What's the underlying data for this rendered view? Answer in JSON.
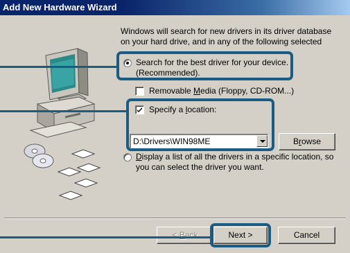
{
  "window": {
    "title": "Add New Hardware Wizard"
  },
  "intro_text": "Windows will search for new drivers in its driver database on your hard drive, and in any of the following selected",
  "options": {
    "search_best": {
      "line1": "Search for the best driver for your device.",
      "line2": "(Recommended).",
      "selected": true
    },
    "removable_media": {
      "label_pre": "Removable ",
      "label_u": "M",
      "label_post": "edia (Floppy, CD-ROM...)",
      "checked": false
    },
    "specify_location": {
      "label_pre": "Specify a ",
      "label_u": "l",
      "label_post": "ocation:",
      "checked": true,
      "path_value": "D:\\Drivers\\WIN98ME"
    },
    "display_list": {
      "line1_u": "D",
      "line1_post": "isplay a list of all the drivers in a specific location, so",
      "line2": "you can select the driver you want.",
      "selected": false
    }
  },
  "buttons": {
    "browse_pre": "B",
    "browse_u": "r",
    "browse_post": "owse",
    "back_pre": "< ",
    "back_u": "B",
    "back_post": "ack",
    "next": "Next >",
    "cancel": "Cancel"
  },
  "colors": {
    "callout": "#1b5c84",
    "face": "#d4d0c8"
  },
  "icons": [
    "computer-icon",
    "cd-disc-icon",
    "floppy-disk-icon"
  ]
}
